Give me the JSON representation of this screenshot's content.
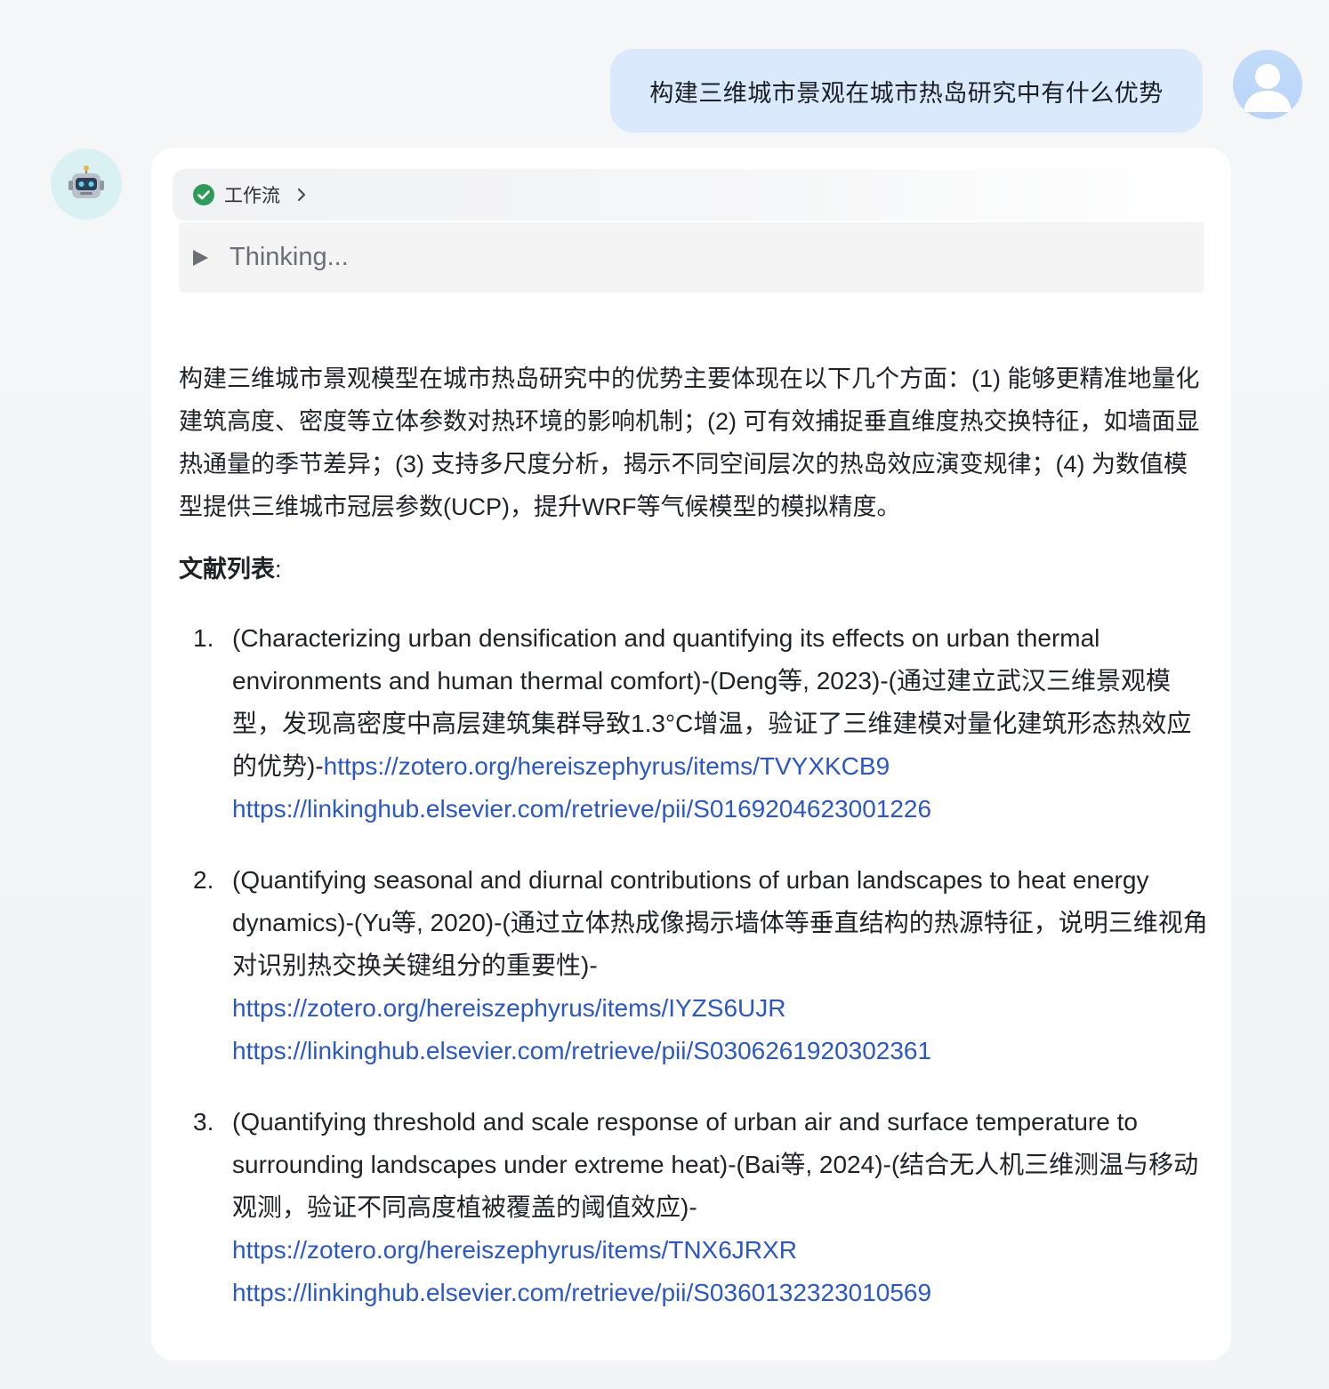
{
  "user_message": {
    "text": "构建三维城市景观在城市热岛研究中有什么优势"
  },
  "bot": {
    "workflow_label": "工作流",
    "thinking_label": "Thinking...",
    "summary": "构建三维城市景观模型在城市热岛研究中的优势主要体现在以下几个方面：(1) 能够更精准地量化建筑高度、密度等立体参数对热环境的影响机制；(2) 可有效捕捉垂直维度热交换特征，如墙面显热通量的季节差异；(3) 支持多尺度分析，揭示不同空间层次的热岛效应演变规律；(4) 为数值模型提供三维城市冠层参数(UCP)，提升WRF等气候模型的模拟精度。",
    "refs_heading": "文献列表",
    "refs_colon": ":",
    "references": [
      {
        "num": "1.",
        "text": "(Characterizing urban densification and quantifying its effects on urban thermal environments and human thermal comfort)-(Deng等, 2023)-(通过建立武汉三维景观模型，发现高密度中高层建筑集群导致1.3°C增温，验证了三维建模对量化建筑形态热效应的优势)-",
        "zotero": "https://zotero.org/hereiszephyrus/items/TVYXKCB9",
        "elsevier": "https://linkinghub.elsevier.com/retrieve/pii/S0169204623001226"
      },
      {
        "num": "2.",
        "text": "(Quantifying seasonal and diurnal contributions of urban landscapes to heat energy dynamics)-(Yu等, 2020)-(通过立体热成像揭示墙体等垂直结构的热源特征，说明三维视角对识别热交换关键组分的重要性)-",
        "zotero": "https://zotero.org/hereiszephyrus/items/IYZS6UJR",
        "elsevier": "https://linkinghub.elsevier.com/retrieve/pii/S0306261920302361"
      },
      {
        "num": "3.",
        "text": "(Quantifying threshold and scale response of urban air and surface temperature to surrounding landscapes under extreme heat)-(Bai等, 2024)-(结合无人机三维测温与移动观测，验证不同高度植被覆盖的阈值效应)-",
        "zotero": "https://zotero.org/hereiszephyrus/items/TNX6JRXR",
        "elsevier": "https://linkinghub.elsevier.com/retrieve/pii/S0360132323010569"
      }
    ]
  },
  "icons": {
    "user_avatar": "user-avatar-icon",
    "bot_avatar": "robot-icon",
    "workflow_status": "check-circle-icon",
    "workflow_expand": "chevron-right-icon",
    "thinking_toggle": "triangle-right-icon"
  },
  "colors": {
    "user_bubble": "#dbe9fd",
    "link": "#2a57c9",
    "check": "#2e9b57",
    "bot_avatar_bg": "#d9f1f3"
  }
}
